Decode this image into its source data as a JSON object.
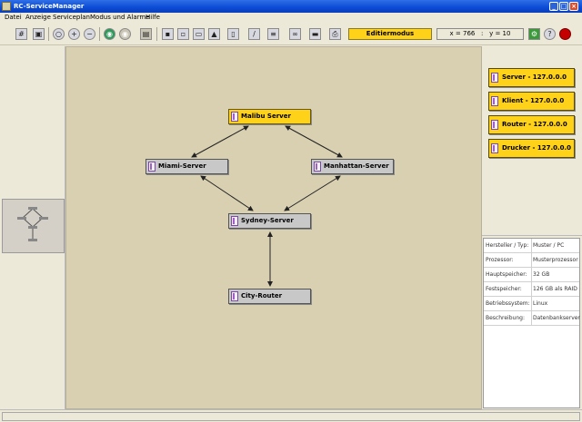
{
  "window": {
    "title": "RC-ServiceManager"
  },
  "menu": [
    "Datei",
    "Anzeige",
    "Serviceplan",
    "Modus und Alarme",
    "Hilfe"
  ],
  "toolbar": {
    "mode_label": "Editiermodus",
    "x_label": "x =",
    "x_value": "766",
    "y_label": "y =",
    "y_value": "10"
  },
  "nodes": [
    {
      "label": "Malibu Server",
      "selected": true
    },
    {
      "label": "Miami-Server",
      "selected": false
    },
    {
      "label": "Manhattan-Server",
      "selected": false
    },
    {
      "label": "Sydney-Server",
      "selected": false
    },
    {
      "label": "City-Router",
      "selected": false
    }
  ],
  "legend": [
    {
      "label": "Server - 127.0.0.0"
    },
    {
      "label": "Klient - 127.0.0.0"
    },
    {
      "label": "Router - 127.0.0.0"
    },
    {
      "label": "Drucker - 127.0.0.0"
    }
  ],
  "properties": [
    {
      "key": "Hersteller / Typ:",
      "value": "Muster / PC"
    },
    {
      "key": "Prozessor:",
      "value": "Musterprozessor"
    },
    {
      "key": "Hauptspeicher:",
      "value": "32 GB"
    },
    {
      "key": "Festspeicher:",
      "value": "126 GB als RAID"
    },
    {
      "key": "Betriebssystem:",
      "value": "Linux"
    },
    {
      "key": "Beschreibung:",
      "value": "Datenbankserver"
    }
  ],
  "colors": {
    "selected_node": "#ffd21a",
    "node": "#c8c8c8",
    "canvas": "#d9d0b2",
    "title_bar": "#0b4bd6"
  }
}
